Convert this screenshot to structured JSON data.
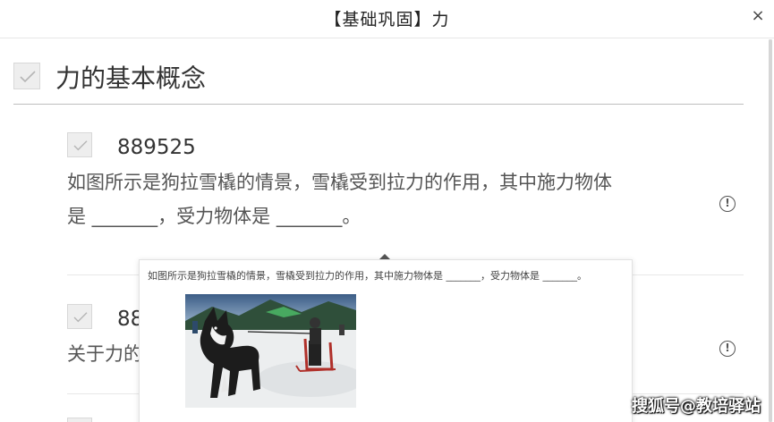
{
  "modal": {
    "title": "【基础巩固】力",
    "close_glyph": "×"
  },
  "section": {
    "title": "力的基本概念"
  },
  "questions": [
    {
      "id": "889525",
      "line1": "如图所示是狗拉雪橇的情景，雪橇受到拉力的作用，其中施力物体",
      "line2": "是 _______，受力物体是 _______。"
    },
    {
      "id": "88",
      "line1": "关于力的"
    }
  ],
  "info_glyph": "!",
  "popover": {
    "text": "如图所示是狗拉雪橇的情景，雪橇受到拉力的作用，其中施力物体是 _______，受力物体是 _______。",
    "image_alt": "dog-pulling-sled-photo"
  },
  "watermark": "搜狐号@教培驿站",
  "colors": {
    "checkbox_bg": "#eeeeee",
    "check_mark": "#b5b5b5",
    "text_primary": "#333333",
    "text_secondary": "#555555",
    "divider": "#bdbdbd"
  }
}
